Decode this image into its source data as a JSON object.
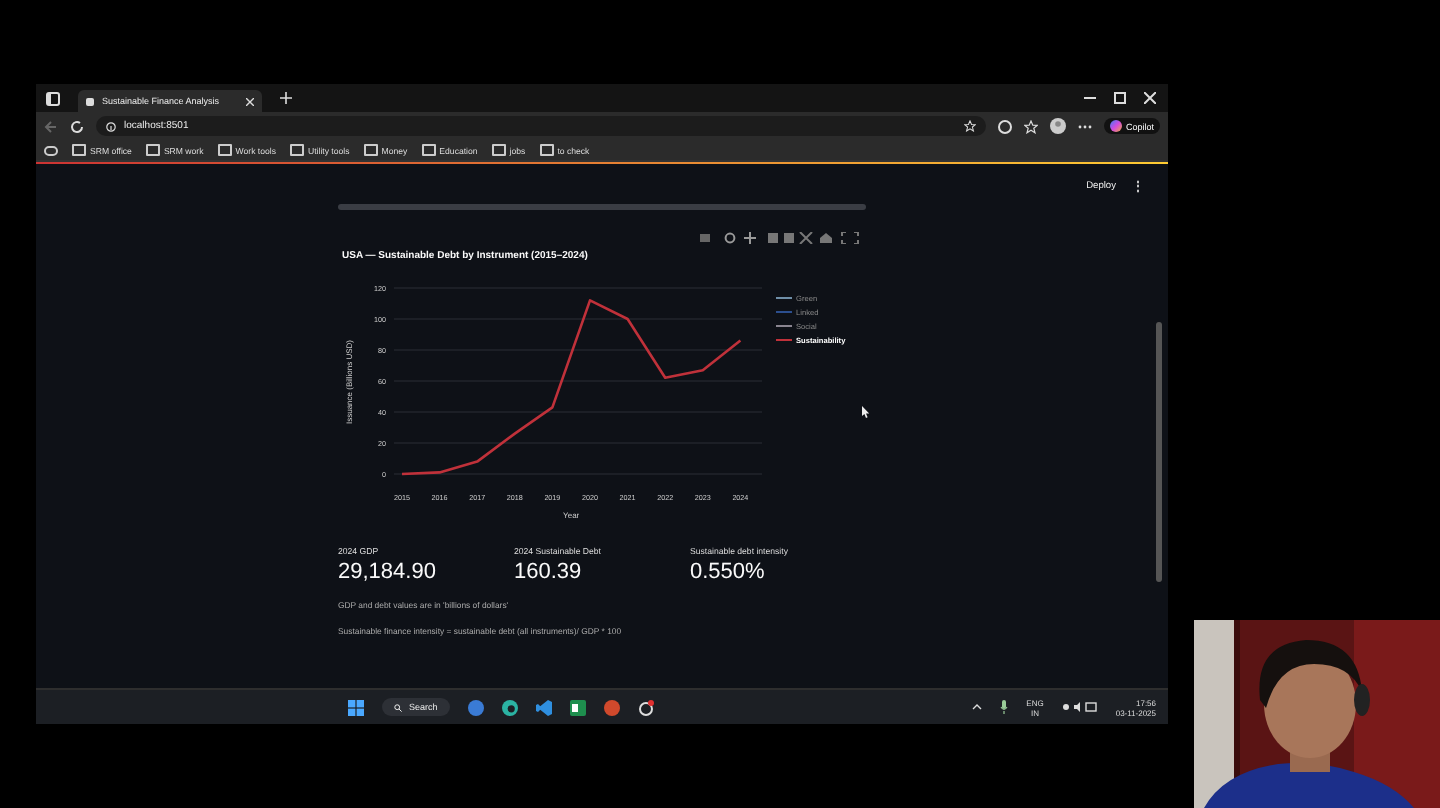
{
  "browser": {
    "tab_title": "Sustainable Finance Analysis",
    "url": "localhost:8501",
    "copilot": "Copilot",
    "bookmarks": [
      "SRM office",
      "SRM work",
      "Work tools",
      "Utility tools",
      "Money",
      "Education",
      "jobs",
      "to check"
    ]
  },
  "app": {
    "deploy": "Deploy",
    "menu": "⋮",
    "chart": {
      "legend": [
        {
          "label": "Green",
          "color": "#6f8fa8",
          "hidden": true
        },
        {
          "label": "Linked",
          "color": "#2c4f8f",
          "hidden": true
        },
        {
          "label": "Social",
          "color": "#8a8590",
          "hidden": true
        }
      ],
      "chart_data": {
        "type": "line",
        "title": "USA — Sustainable Debt by Instrument (2015–2024)",
        "xlabel": "Year",
        "ylabel": "Issuance (Billions USD)",
        "categories": [
          "2015",
          "2016",
          "2017",
          "2018",
          "2019",
          "2020",
          "2021",
          "2022",
          "2023",
          "2024"
        ],
        "series": [
          {
            "name": "Sustainability",
            "color": "#c0313a",
            "values": [
              0,
              1,
              8,
              26,
              43,
              112,
              100,
              62,
              67,
              86
            ]
          }
        ],
        "grid": true,
        "ylim": [
          0,
          120
        ],
        "yticks": [
          0,
          20,
          40,
          60,
          80,
          100,
          120
        ]
      }
    },
    "metrics": [
      {
        "label": "2024 GDP",
        "value": "29,184.90"
      },
      {
        "label": "2024 Sustainable Debt",
        "value": "160.39"
      },
      {
        "label": "Sustainable debt intensity",
        "value": "0.550%"
      }
    ],
    "notes": [
      "GDP and debt values are in 'billions of dollars'",
      "Sustainable finance intensity = sustainable debt (all instruments)/ GDP * 100"
    ]
  },
  "taskbar": {
    "search": "Search",
    "language": "ENG",
    "region": "IN",
    "time": "17:56",
    "date": "03-11-2025"
  }
}
